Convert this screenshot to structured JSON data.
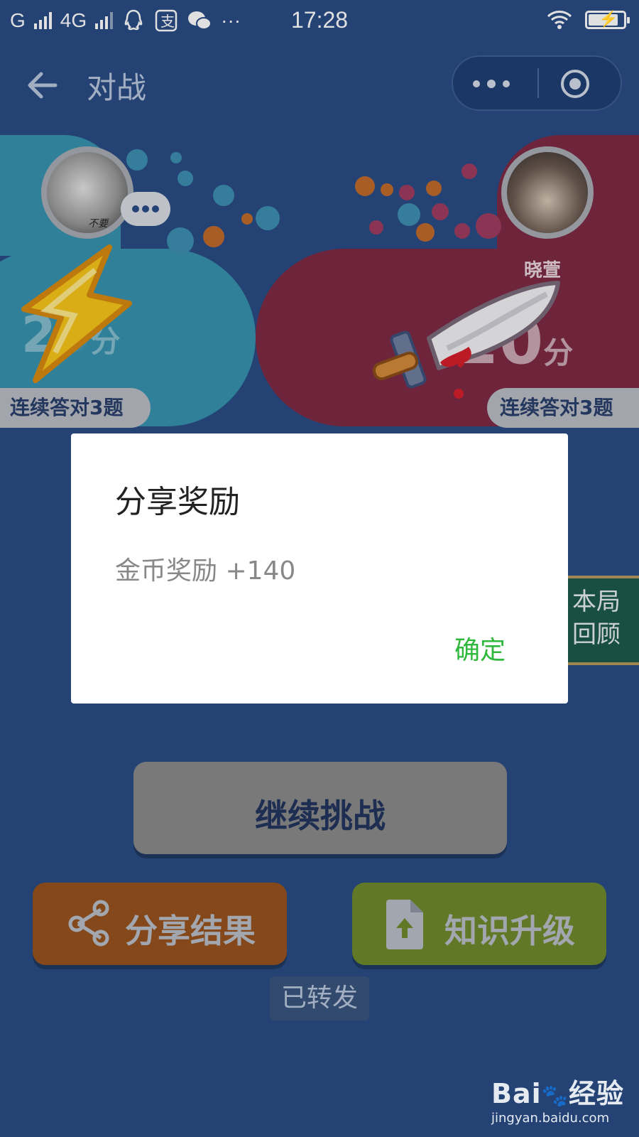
{
  "status_bar": {
    "left_network_1": "G",
    "left_network_2": "4G",
    "left_icons": [
      "qq-icon",
      "alipay-icon",
      "wechat-icon",
      "more-dots-icon"
    ],
    "more": "···",
    "time": "17:28",
    "right_icons": [
      "wifi-icon",
      "battery-charging-icon"
    ],
    "battery_level": 0.85
  },
  "nav": {
    "title": "对战",
    "back_icon": "back-arrow-icon",
    "capsule_icons": [
      "more-dots-icon",
      "target-circle-icon"
    ]
  },
  "battle": {
    "left_player": {
      "avatar_tag": "不要",
      "score_visible": "2",
      "score_hidden_tail": "0",
      "score_unit": "分",
      "streak": "连续答对3题",
      "effect_icon": "lightning-icon"
    },
    "right_player": {
      "name": "晓萱",
      "score_visible": "20",
      "score_unit": "分",
      "streak": "连续答对3题",
      "effect_icon": "knife-icon"
    }
  },
  "review_button": {
    "line1": "本局",
    "line2": "回顾"
  },
  "dialog": {
    "title": "分享奖励",
    "message": "金币奖励 +140",
    "confirm": "确定"
  },
  "actions": {
    "continue": "继续挑战",
    "share": "分享结果",
    "upgrade": "知识升级",
    "forwarded": "已转发"
  },
  "watermark": {
    "brand": "Bai",
    "brand_suffix": "经验",
    "url": "jingyan.baidu.com"
  },
  "colors": {
    "background": "#2a4d85",
    "left_player": "#3692ad",
    "right_player": "#7e2944",
    "confirm_green": "#2fb83b",
    "share_orange": "#97521f",
    "upgrade_green": "#6f8a2c",
    "review_green": "#1d5a4c"
  }
}
